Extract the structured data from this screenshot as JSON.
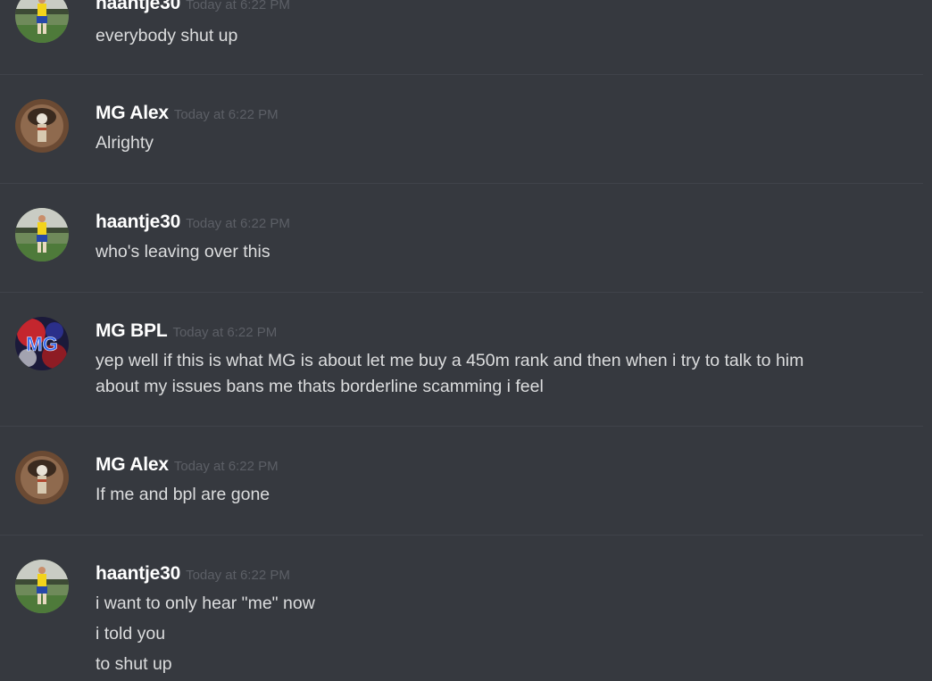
{
  "messages": [
    {
      "author": "haantje30",
      "avatar": "player-photo-avatar",
      "timestamp": "Today at 6:22 PM",
      "lines": [
        "everybody shut up"
      ]
    },
    {
      "author": "MG Alex",
      "avatar": "cigar-photo-avatar",
      "timestamp": "Today at 6:22 PM",
      "lines": [
        "Alrighty"
      ]
    },
    {
      "author": "haantje30",
      "avatar": "player-photo-avatar",
      "timestamp": "Today at 6:22 PM",
      "lines": [
        "who's leaving over this"
      ]
    },
    {
      "author": "MG BPL",
      "avatar": "mg-logo-avatar",
      "avatar_text": "MG",
      "timestamp": "Today at 6:22 PM",
      "lines": [
        "yep well if this is what MG is about let me buy a 450m rank and then when i try to talk to him",
        "about my issues bans me thats borderline scamming i feel"
      ]
    },
    {
      "author": "MG Alex",
      "avatar": "cigar-photo-avatar",
      "timestamp": "Today at 6:22 PM",
      "lines": [
        "If me and bpl are gone"
      ]
    },
    {
      "author": "haantje30",
      "avatar": "player-photo-avatar",
      "timestamp": "Today at 6:22 PM",
      "lines": [
        "i want to only hear \"me\" now",
        "i told you",
        "to shut up"
      ]
    }
  ],
  "colors": {
    "background": "#36393f",
    "username": "#ffffff",
    "message_text": "#dcddde",
    "timestamp": "#5c5f66",
    "divider": "#40434a"
  }
}
